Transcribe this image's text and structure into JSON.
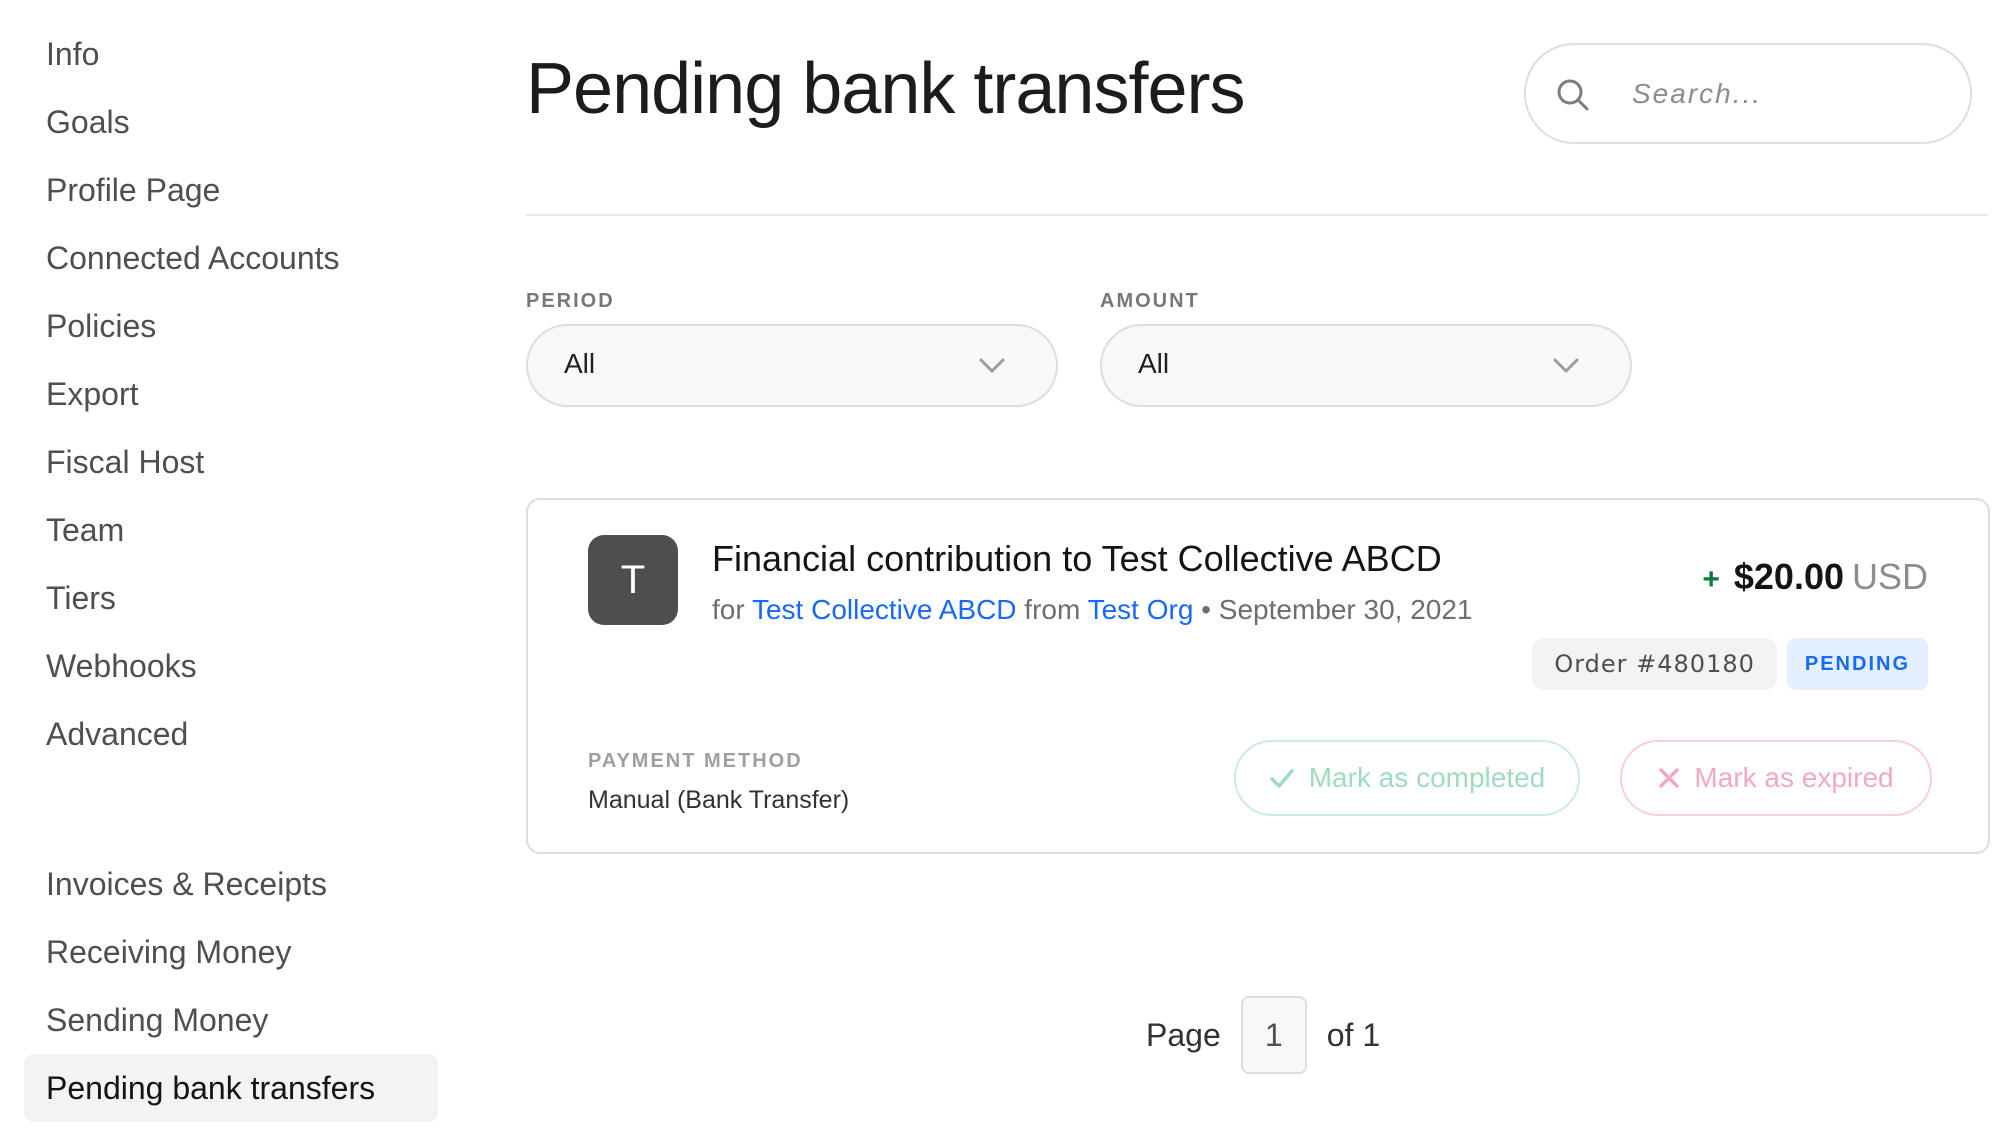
{
  "sidebar": {
    "items": [
      {
        "label": "Info"
      },
      {
        "label": "Goals"
      },
      {
        "label": "Profile Page"
      },
      {
        "label": "Connected Accounts"
      },
      {
        "label": "Policies"
      },
      {
        "label": "Export"
      },
      {
        "label": "Fiscal Host"
      },
      {
        "label": "Team"
      },
      {
        "label": "Tiers"
      },
      {
        "label": "Webhooks"
      },
      {
        "label": "Advanced"
      }
    ],
    "items2": [
      {
        "label": "Invoices & Receipts"
      },
      {
        "label": "Receiving Money"
      },
      {
        "label": "Sending Money"
      },
      {
        "label": "Pending bank transfers",
        "active": true
      }
    ]
  },
  "header": {
    "title": "Pending bank transfers",
    "search_placeholder": "Search..."
  },
  "filters": {
    "period": {
      "label": "PERIOD",
      "value": "All"
    },
    "amount": {
      "label": "AMOUNT",
      "value": "All"
    }
  },
  "transfer": {
    "avatar_letter": "T",
    "title": "Financial contribution to Test Collective ABCD",
    "for_text": "for",
    "collective": "Test Collective ABCD",
    "from_text": "from",
    "from_org": "Test Org",
    "separator": "•",
    "date": "September 30, 2021",
    "amount_sign": "+",
    "amount": "$20.00",
    "currency": "USD",
    "order": "Order #480180",
    "status": "PENDING",
    "payment_method_label": "PAYMENT METHOD",
    "payment_method": "Manual (Bank Transfer)",
    "complete_label": "Mark as completed",
    "expire_label": "Mark as expired"
  },
  "pagination": {
    "page_label": "Page",
    "current": "1",
    "of_label": "of 1"
  },
  "colors": {
    "link": "#1869f5",
    "positive": "#0a7a3f",
    "pending_bg": "#e4f0ff"
  }
}
